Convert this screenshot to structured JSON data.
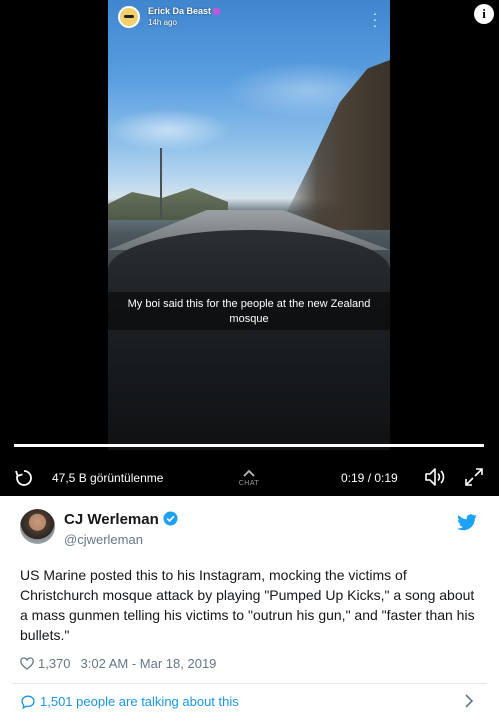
{
  "video": {
    "snap_user": "Erick Da Beast",
    "snap_time": "14h ago",
    "caption": "My boi said this for the people at the new Zealand mosque",
    "progress": 1.0,
    "views": "47,5 B görüntülenme",
    "chat_label": "CHAT",
    "time": "0:19 / 0:19",
    "info_glyph": "i"
  },
  "tweet": {
    "display_name": "CJ Werleman",
    "handle": "@cjwerleman",
    "text": "US Marine posted this to his Instagram, mocking the victims of Christchurch mosque attack by playing \"Pumped Up Kicks,\" a song about a mass gunmen telling his victims to \"outrun his gun,\" and \"faster than his bullets.\"",
    "likes": "1,370",
    "timestamp": "3:02 AM - Mar 18, 2019",
    "talking": "1,501 people are talking about this"
  },
  "colors": {
    "twitter_blue": "#1da1f2",
    "link_blue": "#1b95e0",
    "muted": "#657786",
    "text": "#14171a",
    "video_bg": "#000000"
  },
  "icons": [
    "info-icon",
    "more-vertical-icon",
    "replay-icon",
    "chevron-up-icon",
    "volume-icon",
    "fullscreen-icon",
    "verified-icon",
    "twitter-bird-icon",
    "heart-icon",
    "comment-bubble-icon",
    "chevron-right-icon"
  ]
}
